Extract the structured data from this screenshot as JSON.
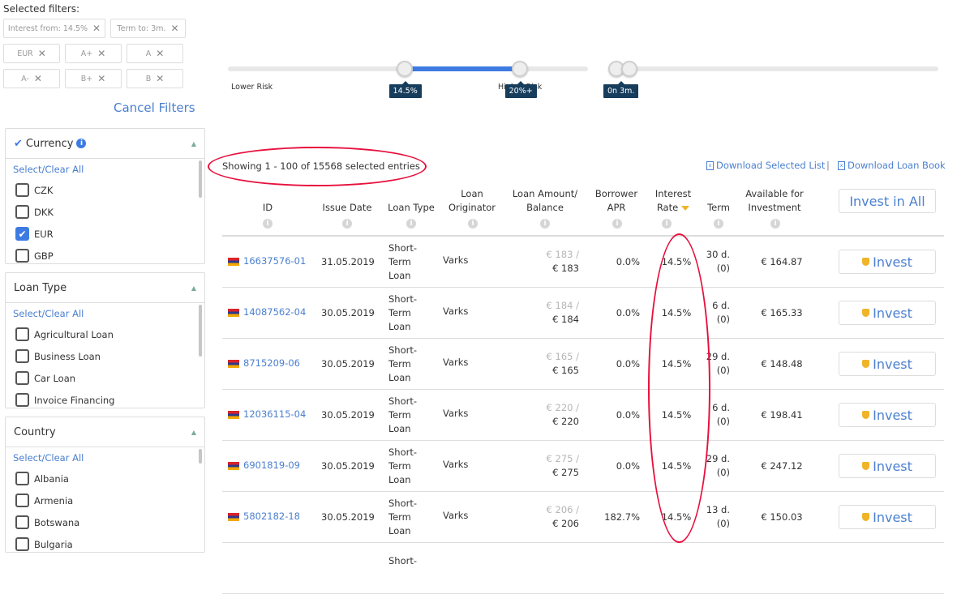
{
  "selected_filters": {
    "title": "Selected filters:",
    "chips": [
      {
        "label": "Interest from: 14.5%"
      },
      {
        "label": "Term to: 3m."
      },
      {
        "label": "EUR"
      },
      {
        "label": "A+"
      },
      {
        "label": "A"
      },
      {
        "label": "A-"
      },
      {
        "label": "B+"
      },
      {
        "label": "B"
      }
    ],
    "remove_glyph": "✕",
    "cancel_label": "Cancel Filters"
  },
  "sliders": {
    "interest": {
      "low_label": "Lower Risk",
      "high_label": "Higher Risk",
      "from_value": "14.5%",
      "to_value": "20%+",
      "from_fraction": 0.49,
      "to_fraction": 0.81
    },
    "term": {
      "from_value": "0n",
      "to_value": "3m.",
      "from_fraction": 0.0,
      "to_fraction": 0.04
    }
  },
  "panels": [
    {
      "title": "Currency",
      "checked_mark": "✔",
      "info_icon": "i",
      "select_all": "Select/Clear All",
      "options": [
        {
          "label": "CZK",
          "checked": false
        },
        {
          "label": "DKK",
          "checked": false
        },
        {
          "label": "EUR",
          "checked": true
        },
        {
          "label": "GBP",
          "checked": false
        }
      ]
    },
    {
      "title": "Loan Type",
      "select_all": "Select/Clear All",
      "options": [
        {
          "label": "Agricultural Loan",
          "checked": false
        },
        {
          "label": "Business Loan",
          "checked": false
        },
        {
          "label": "Car Loan",
          "checked": false
        },
        {
          "label": "Invoice Financing",
          "checked": false
        }
      ]
    },
    {
      "title": "Country",
      "select_all": "Select/Clear All",
      "options": [
        {
          "label": "Albania",
          "checked": false
        },
        {
          "label": "Armenia",
          "checked": false
        },
        {
          "label": "Botswana",
          "checked": false
        },
        {
          "label": "Bulgaria",
          "checked": false
        }
      ]
    }
  ],
  "results": {
    "showing": "Showing 1 - 100 of 15568 selected entries",
    "download_selected": "Download Selected List",
    "separator": "|",
    "download_book": "Download Loan Book"
  },
  "table": {
    "headers": [
      {
        "label": "ID"
      },
      {
        "label": "Issue Date"
      },
      {
        "label": "Loan Type"
      },
      {
        "label": "Loan\nOriginator"
      },
      {
        "label": "Loan Amount/\nBalance"
      },
      {
        "label": "Borrower\nAPR"
      },
      {
        "label": "Interest\nRate",
        "sorted": "desc"
      },
      {
        "label": "Term"
      },
      {
        "label": "Available for\nInvestment"
      }
    ],
    "invest_all_label": "Invest in All",
    "invest_label": "Invest",
    "rows": [
      {
        "flag": "Armenia",
        "id": "16637576-01",
        "issue_date": "31.05.2019",
        "loan_type": [
          "Short-",
          "Term",
          "Loan"
        ],
        "originator": "Varks",
        "amount": "€ 183 /",
        "balance": "€ 183",
        "apr": "0.0%",
        "rate": "14.5%",
        "term": "30 d.",
        "term_ext": "(0)",
        "available": "€ 164.87"
      },
      {
        "flag": "Armenia",
        "id": "14087562-04",
        "issue_date": "30.05.2019",
        "loan_type": [
          "Short-",
          "Term",
          "Loan"
        ],
        "originator": "Varks",
        "amount": "€ 184 /",
        "balance": "€ 184",
        "apr": "0.0%",
        "rate": "14.5%",
        "term": "6 d.",
        "term_ext": "(0)",
        "available": "€ 165.33"
      },
      {
        "flag": "Armenia",
        "id": "8715209-06",
        "issue_date": "30.05.2019",
        "loan_type": [
          "Short-",
          "Term",
          "Loan"
        ],
        "originator": "Varks",
        "amount": "€ 165 /",
        "balance": "€ 165",
        "apr": "0.0%",
        "rate": "14.5%",
        "term": "29 d.",
        "term_ext": "(0)",
        "available": "€ 148.48"
      },
      {
        "flag": "Armenia",
        "id": "12036115-04",
        "issue_date": "30.05.2019",
        "loan_type": [
          "Short-",
          "Term",
          "Loan"
        ],
        "originator": "Varks",
        "amount": "€ 220 /",
        "balance": "€ 220",
        "apr": "0.0%",
        "rate": "14.5%",
        "term": "6 d.",
        "term_ext": "(0)",
        "available": "€ 198.41"
      },
      {
        "flag": "Armenia",
        "id": "6901819-09",
        "issue_date": "30.05.2019",
        "loan_type": [
          "Short-",
          "Term",
          "Loan"
        ],
        "originator": "Varks",
        "amount": "€ 275 /",
        "balance": "€ 275",
        "apr": "0.0%",
        "rate": "14.5%",
        "term": "29 d.",
        "term_ext": "(0)",
        "available": "€ 247.12"
      },
      {
        "flag": "Armenia",
        "id": "5802182-18",
        "issue_date": "30.05.2019",
        "loan_type": [
          "Short-",
          "Term",
          "Loan"
        ],
        "originator": "Varks",
        "amount": "€ 206 /",
        "balance": "€ 206",
        "apr": "182.7%",
        "rate": "14.5%",
        "term": "13 d.",
        "term_ext": "(0)",
        "available": "€ 150.03"
      },
      {
        "partial": true,
        "loan_type": [
          "Short-"
        ]
      }
    ]
  },
  "colors": {
    "accent": "#4a7fd0",
    "slider_fill": "#3d7be3",
    "tooltip_bg": "#163d5c",
    "shield": "#f0b429",
    "annotation_red": "#e8103d"
  }
}
